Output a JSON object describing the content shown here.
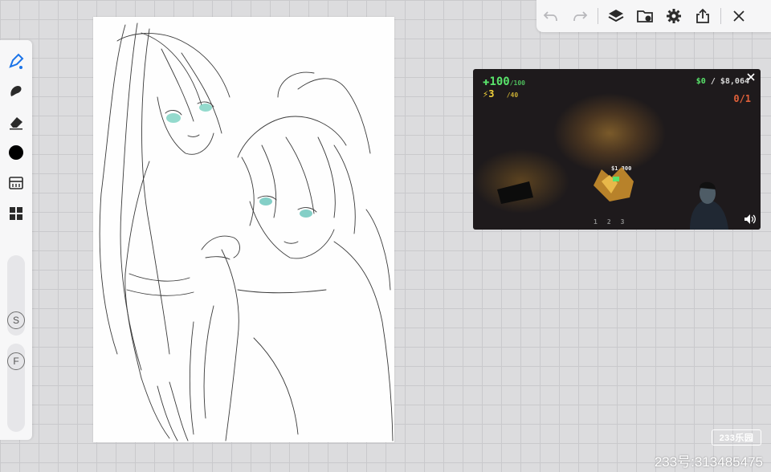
{
  "toolbar": {
    "buttons": [
      {
        "name": "undo-icon",
        "enabled": false
      },
      {
        "name": "redo-icon",
        "enabled": false
      },
      {
        "name": "layers-icon",
        "enabled": true
      },
      {
        "name": "gallery-icon",
        "enabled": true
      },
      {
        "name": "settings-icon",
        "enabled": true
      },
      {
        "name": "share-icon",
        "enabled": true
      },
      {
        "name": "close-icon",
        "enabled": true
      }
    ]
  },
  "tools": [
    {
      "name": "brush-icon",
      "active": true
    },
    {
      "name": "smudge-icon",
      "active": false
    },
    {
      "name": "eraser-icon",
      "active": false
    },
    {
      "name": "color-swatch",
      "color": "#000000"
    },
    {
      "name": "gallery-icon",
      "active": false
    },
    {
      "name": "grid-icon",
      "active": false
    }
  ],
  "sliders": {
    "size_label": "S",
    "flow_label": "F"
  },
  "video": {
    "health": "100",
    "health_max": "/100",
    "ammo": "3",
    "ammo_max": "/40",
    "money": "$0",
    "money_goal": "$8,064",
    "kills": "0/1",
    "floating_price": "$1,300",
    "slots": [
      "1",
      "2",
      "3"
    ]
  },
  "watermark": {
    "logo_text": "233乐园",
    "id_text": "233号:313485475"
  },
  "colors": {
    "accent": "#1a73e8",
    "hud_green": "#59e36b",
    "hud_yellow": "#f2d13a",
    "hud_red": "#e0603a"
  }
}
